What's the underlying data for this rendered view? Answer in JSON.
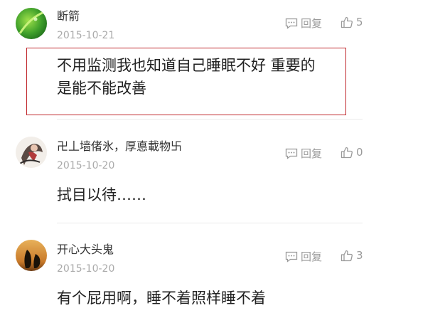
{
  "comments": [
    {
      "username": "断箭",
      "date": "2015-10-21",
      "reply_label": "回复",
      "like_count": "5",
      "content_lines": [
        "不用监测我也知道自己睡眠不好 重要的",
        "是能不能改善"
      ],
      "avatar_theme": "green-leaf"
    },
    {
      "username": "卍丄墙偖氷，厚悳載物卐",
      "date": "2015-10-20",
      "reply_label": "回复",
      "like_count": "0",
      "content_lines": [
        "拭目以待……"
      ],
      "avatar_theme": "anime-figure"
    },
    {
      "username": "开心大头鬼",
      "date": "2015-10-20",
      "reply_label": "回复",
      "like_count": "3",
      "content_lines": [
        "有个屁用啊，睡不着照样睡不着"
      ],
      "avatar_theme": "penguins-sunset"
    }
  ],
  "colors": {
    "highlight_border": "#c0282d",
    "meta_text": "#9a9a9a",
    "date_text": "#aaaaaa"
  },
  "icons": {
    "reply": "comment-icon",
    "like": "thumbs-up-icon"
  }
}
